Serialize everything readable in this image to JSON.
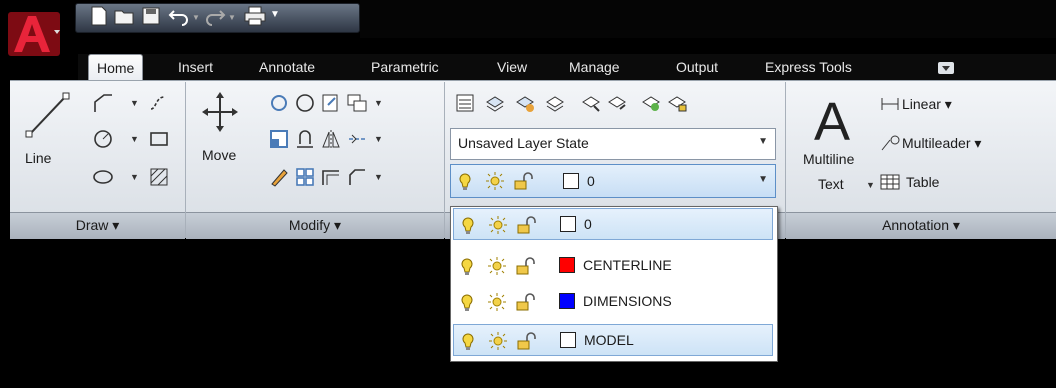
{
  "quick_access": {
    "icons": [
      "new-icon",
      "open-icon",
      "save-icon",
      "undo-icon",
      "redo-icon",
      "plot-icon",
      "customize-icon"
    ]
  },
  "tabs": [
    {
      "label": "Home",
      "active": true
    },
    {
      "label": "Insert"
    },
    {
      "label": "Annotate"
    },
    {
      "label": "Parametric"
    },
    {
      "label": "View"
    },
    {
      "label": "Manage"
    },
    {
      "label": "Output"
    },
    {
      "label": "Express Tools"
    }
  ],
  "draw_panel": {
    "line_label": "Line",
    "title": "Draw ▾"
  },
  "modify_panel": {
    "move_label": "Move",
    "title": "Modify ▾"
  },
  "layers_panel": {
    "layer_state": "Unsaved Layer State",
    "current_layer": "0"
  },
  "layer_dropdown": {
    "items": [
      {
        "name": "0",
        "color": "#ffffff"
      },
      {
        "name": "CENTERLINE",
        "color": "#ff0000"
      },
      {
        "name": "DIMENSIONS",
        "color": "#0000ff"
      },
      {
        "name": "MODEL",
        "color": "#ffffff"
      }
    ]
  },
  "annotation_panel": {
    "text_label_1": "Multiline",
    "text_label_2": "Text",
    "linear": "Linear ▾",
    "multileader": "Multileader ▾",
    "table": "Table",
    "title": "Annotation ▾"
  },
  "colors": {
    "accent": "#c8102e",
    "ribbon": "#e6eaef",
    "highlight": "#cde3f6"
  }
}
